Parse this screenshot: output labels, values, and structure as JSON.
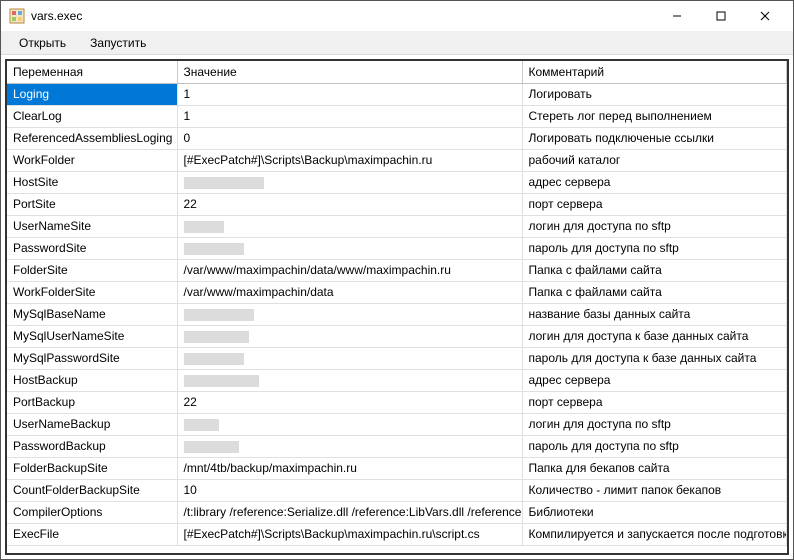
{
  "window": {
    "title": "vars.exec"
  },
  "menu": {
    "open": "Открыть",
    "run": "Запустить"
  },
  "columns": {
    "variable": "Переменная",
    "value": "Значение",
    "comment": "Комментарий"
  },
  "rows": [
    {
      "var": "Loging",
      "val": "1",
      "comment": "Логировать",
      "selected": true
    },
    {
      "var": "ClearLog",
      "val": "1",
      "comment": "Стереть лог перед выполнением"
    },
    {
      "var": "ReferencedAssembliesLoging",
      "val": "0",
      "comment": "Логировать подключеные ссылки"
    },
    {
      "var": "WorkFolder",
      "val": "[#ExecPatch#]\\Scripts\\Backup\\maximpachin.ru",
      "comment": "рабочий каталог"
    },
    {
      "var": "HostSite",
      "val": "",
      "redacted": 80,
      "comment": "адрес сервера"
    },
    {
      "var": "PortSite",
      "val": "22",
      "comment": "порт сервера"
    },
    {
      "var": "UserNameSite",
      "val": "",
      "redacted": 40,
      "comment": "логин для доступа по sftp"
    },
    {
      "var": "PasswordSite",
      "val": "",
      "redacted": 60,
      "comment": "пароль для доступа по sftp"
    },
    {
      "var": "FolderSite",
      "val": "/var/www/maximpachin/data/www/maximpachin.ru",
      "comment": "Папка с файлами сайта"
    },
    {
      "var": "WorkFolderSite",
      "val": "/var/www/maximpachin/data",
      "comment": "Папка с файлами сайта"
    },
    {
      "var": "MySqlBaseName",
      "val": "",
      "redacted": 70,
      "comment": "название базы данных сайта"
    },
    {
      "var": "MySqlUserNameSite",
      "val": "",
      "redacted": 65,
      "comment": "логин для доступа к базе данных сайта"
    },
    {
      "var": "MySqlPasswordSite",
      "val": "",
      "redacted": 60,
      "comment": "пароль для доступа к базе данных сайта"
    },
    {
      "var": "HostBackup",
      "val": "",
      "redacted": 75,
      "comment": "адрес сервера"
    },
    {
      "var": "PortBackup",
      "val": "22",
      "comment": "порт сервера"
    },
    {
      "var": "UserNameBackup",
      "val": "",
      "redacted": 35,
      "comment": "логин для доступа по sftp"
    },
    {
      "var": "PasswordBackup",
      "val": "",
      "redacted": 55,
      "comment": "пароль для доступа по sftp"
    },
    {
      "var": "FolderBackupSite",
      "val": "/mnt/4tb/backup/maximpachin.ru",
      "comment": "Папка для бекапов сайта"
    },
    {
      "var": "CountFolderBackupSite",
      "val": "10",
      "comment": "Количество - лимит папок бекапов"
    },
    {
      "var": "CompilerOptions",
      "val": "/t:library /reference:Serialize.dll /reference:LibVars.dll /reference:ssh.dll",
      "comment": "Библиотеки"
    },
    {
      "var": "ExecFile",
      "val": "[#ExecPatch#]\\Scripts\\Backup\\maximpachin.ru\\script.cs",
      "comment": "Компилируется и запускается после подготовки данных"
    }
  ]
}
